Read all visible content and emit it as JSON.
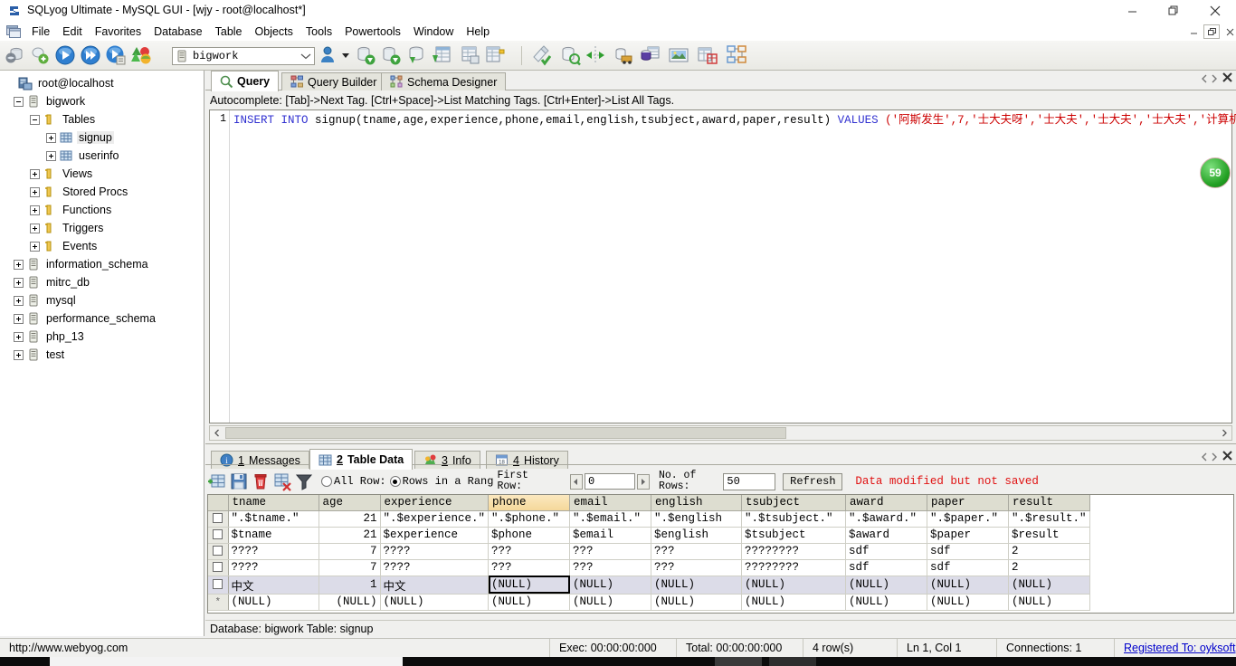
{
  "window": {
    "title": "SQLyog Ultimate - MySQL GUI - [wjy - root@localhost*]",
    "app_icon": "sqlyog-icon",
    "minimize": "minimize-icon",
    "maximize": "maximize-icon",
    "close": "close-icon"
  },
  "menu": {
    "mdi_icon": "mdi-window-icon",
    "items": [
      "File",
      "Edit",
      "Favorites",
      "Database",
      "Table",
      "Objects",
      "Tools",
      "Powertools",
      "Window",
      "Help"
    ],
    "mdi_minimize": "mdi-minimize-icon",
    "mdi_restore": "mdi-restore-icon",
    "mdi_close": "mdi-close-icon"
  },
  "toolbar": {
    "database_combo_value": "bigwork",
    "database_combo_icon": "database-icon",
    "buttons": [
      "new-connection-icon",
      "refresh-object-browser-icon",
      "execute-query-icon",
      "execute-all-queries-icon",
      "execute-query-and-log-icon",
      "stop-query-icon",
      "import-external-data-icon",
      "import-csv-icon",
      "backup-database-icon",
      "export-as-sql-icon",
      "user-manager-icon",
      "sql-formatter-icon",
      "schema-sync-icon",
      "data-sync-icon",
      "tunnel-icon",
      "scheduled-backup-icon",
      "notification-services-icon",
      "query-profiler-icon",
      "visual-compare-icon"
    ]
  },
  "object_browser": {
    "nodes": [
      {
        "label": "root@localhost",
        "icon": "host-icon",
        "indent": 0,
        "state": "none",
        "selected": false
      },
      {
        "label": "bigwork",
        "icon": "database-icon",
        "indent": 1,
        "state": "minus",
        "selected": false
      },
      {
        "label": "Tables",
        "icon": "folder-icon",
        "indent": 2,
        "state": "minus",
        "selected": false
      },
      {
        "label": "signup",
        "icon": "table-icon",
        "indent": 3,
        "state": "plus",
        "selected": true
      },
      {
        "label": "userinfo",
        "icon": "table-icon",
        "indent": 3,
        "state": "plus",
        "selected": false
      },
      {
        "label": "Views",
        "icon": "folder-icon",
        "indent": 2,
        "state": "plus",
        "selected": false
      },
      {
        "label": "Stored Procs",
        "icon": "folder-icon",
        "indent": 2,
        "state": "plus",
        "selected": false
      },
      {
        "label": "Functions",
        "icon": "folder-icon",
        "indent": 2,
        "state": "plus",
        "selected": false
      },
      {
        "label": "Triggers",
        "icon": "folder-icon",
        "indent": 2,
        "state": "plus",
        "selected": false
      },
      {
        "label": "Events",
        "icon": "folder-icon",
        "indent": 2,
        "state": "plus",
        "selected": false
      },
      {
        "label": "information_schema",
        "icon": "database-icon",
        "indent": 1,
        "state": "plus",
        "selected": false
      },
      {
        "label": "mitrc_db",
        "icon": "database-icon",
        "indent": 1,
        "state": "plus",
        "selected": false
      },
      {
        "label": "mysql",
        "icon": "database-icon",
        "indent": 1,
        "state": "plus",
        "selected": false
      },
      {
        "label": "performance_schema",
        "icon": "database-icon",
        "indent": 1,
        "state": "plus",
        "selected": false
      },
      {
        "label": "php_13",
        "icon": "database-icon",
        "indent": 1,
        "state": "plus",
        "selected": false
      },
      {
        "label": "test",
        "icon": "database-icon",
        "indent": 1,
        "state": "plus",
        "selected": false
      }
    ]
  },
  "editor": {
    "tabs": [
      {
        "label": "Query",
        "icon": "query-icon",
        "active": true
      },
      {
        "label": "Query Builder",
        "icon": "query-builder-icon",
        "active": false
      },
      {
        "label": "Schema Designer",
        "icon": "schema-designer-icon",
        "active": false
      }
    ],
    "autocomplete_hint": "Autocomplete: [Tab]->Next Tag. [Ctrl+Space]->List Matching Tags. [Ctrl+Enter]->List All Tags.",
    "line_number": "1",
    "sql": {
      "kw1": "INSERT INTO",
      "table_and_cols": " signup(tname,age,experience,phone,email,english,tsubject,award,paper,result) ",
      "kw2": "VALUES",
      "values": " ('阿斯发生',7,'士大夫呀','士大夫','士大夫','士大夫','计算机"
    },
    "badge": "59",
    "nav_prev": "prev-tab-icon",
    "nav_next": "next-tab-icon",
    "tab_close": "close-tab-icon"
  },
  "results": {
    "tabs": [
      {
        "num": "1",
        "label": " Messages",
        "icon": "messages-icon",
        "active": false
      },
      {
        "num": "2",
        "label": " Table Data",
        "icon": "table-data-icon",
        "active": true
      },
      {
        "num": "3",
        "label": " Info",
        "icon": "info-icon",
        "active": false
      },
      {
        "num": "4",
        "label": " History",
        "icon": "history-icon",
        "active": false
      }
    ],
    "grid_toolbar": {
      "icons": [
        "insert-row-icon",
        "save-changes-icon",
        "delete-row-icon",
        "refresh-data-icon",
        "filter-icon"
      ],
      "radio_all": "All Row:",
      "radio_range": "Rows in a Rang",
      "radio_selected": "range",
      "first_row_label": "First\nRow:",
      "first_row_value": "0",
      "no_of_rows_label": "No. of\nRows:",
      "no_of_rows_value": "50",
      "refresh_button": "Refresh",
      "status_message": "Data modified but not saved",
      "status_color": "#e01010",
      "spin_left": "prev-page-icon",
      "spin_right": "next-page-icon"
    },
    "grid": {
      "columns": [
        "tname",
        "age",
        "experience",
        "phone",
        "email",
        "english",
        "tsubject",
        "award",
        "paper",
        "result"
      ],
      "highlighted_column": "phone",
      "active_cell": {
        "row": 4,
        "column": "phone"
      },
      "selected_row_index": 4,
      "rows": [
        {
          "marker": "checkbox",
          "cells": [
            "\".$tname.\"",
            "21",
            "\".$experience.\"",
            "\".$phone.\"",
            "\".$email.\"",
            "\".$english",
            "\".$tsubject.\"",
            "\".$award.\"",
            "\".$paper.\"",
            "\".$result.\""
          ]
        },
        {
          "marker": "checkbox",
          "cells": [
            "$tname",
            "21",
            "$experience",
            "$phone",
            "$email",
            "$english",
            "$tsubject",
            "$award",
            "$paper",
            "$result"
          ]
        },
        {
          "marker": "checkbox",
          "cells": [
            "????",
            "7",
            "????",
            "???",
            "???",
            "???",
            "????????",
            "sdf",
            "sdf",
            "2"
          ]
        },
        {
          "marker": "checkbox",
          "cells": [
            "????",
            "7",
            "????",
            "???",
            "???",
            "???",
            "????????",
            "sdf",
            "sdf",
            "2"
          ]
        },
        {
          "marker": "checkbox",
          "cells": [
            "中文",
            "1",
            "中文",
            "(NULL)",
            "(NULL)",
            "(NULL)",
            "(NULL)",
            "(NULL)",
            "(NULL)",
            "(NULL)"
          ]
        },
        {
          "marker": "star",
          "cells": [
            "(NULL)",
            "(NULL)",
            "(NULL)",
            "(NULL)",
            "(NULL)",
            "(NULL)",
            "(NULL)",
            "(NULL)",
            "(NULL)",
            "(NULL)"
          ]
        }
      ]
    },
    "db_info": "Database: bigwork Table: signup"
  },
  "statusbar": {
    "url": "http://www.webyog.com",
    "exec": "Exec: 00:00:00:000",
    "total": "Total: 00:00:00:000",
    "rows": "4 row(s)",
    "cursor": "Ln 1, Col 1",
    "connections": "Connections: 1",
    "registered": "Registered To: oyksoft"
  }
}
